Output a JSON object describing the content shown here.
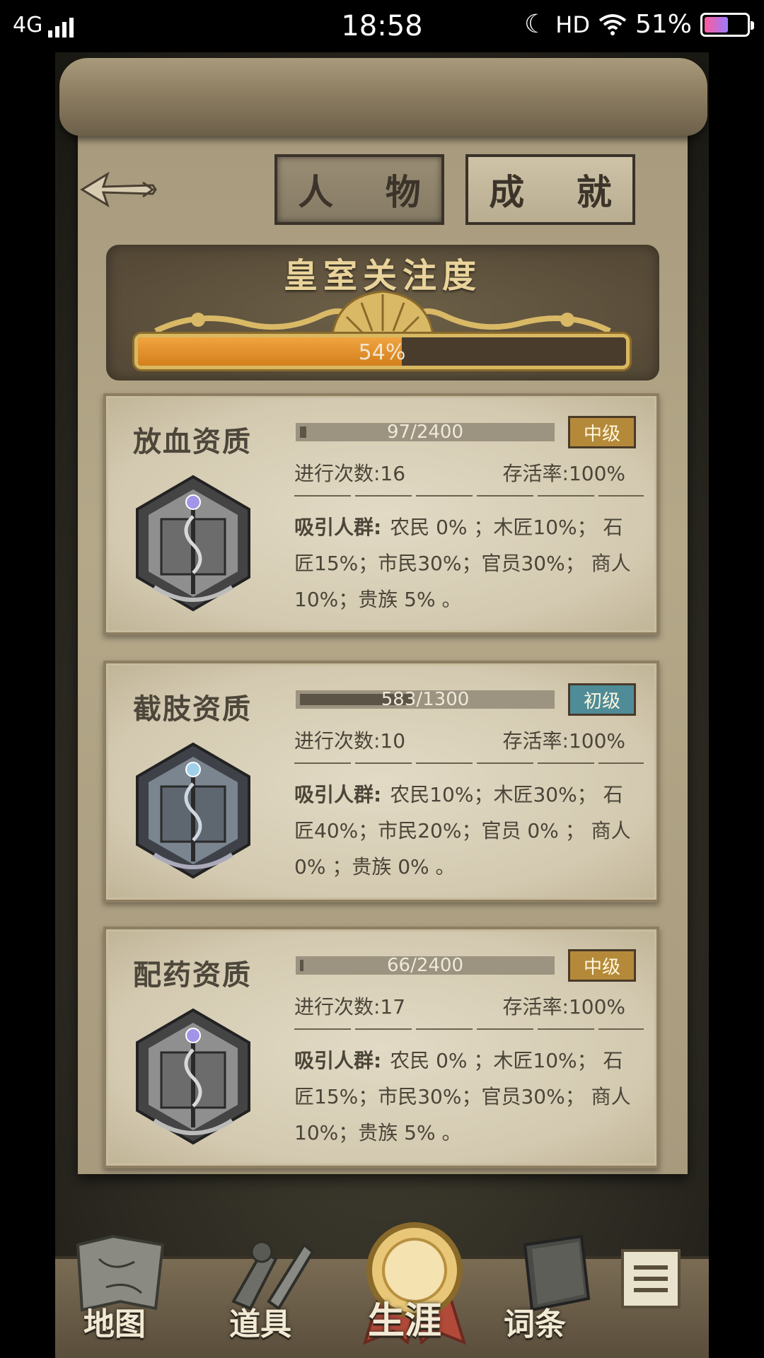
{
  "status_bar": {
    "network": "4G",
    "time": "18:58",
    "hd": "HD",
    "battery": "51%"
  },
  "tabs": {
    "character": "人 物",
    "achievement": "成 就"
  },
  "royal_attention": {
    "title": "皇室关注度",
    "percent_label": "54%",
    "progress": 0.54
  },
  "skills": [
    {
      "name": "放血资质",
      "exp_label": "97/2400",
      "exp_fraction": 0.04,
      "level": "中级",
      "count_label": "进行次数:16",
      "survival_label": "存活率:100%",
      "attract_label": "吸引人群:",
      "attract_text": "农民 0% ；木匠10%； 石匠15%；市民30%；官员30%； 商人10%；贵族 5% 。"
    },
    {
      "name": "截肢资质",
      "exp_label": "583/1300",
      "exp_fraction": 0.45,
      "level": "初级",
      "count_label": "进行次数:10",
      "survival_label": "存活率:100%",
      "attract_label": "吸引人群:",
      "attract_text": "农民10%；木匠30%； 石匠40%；市民20%；官员 0% ； 商人 0% ；贵族 0% 。"
    },
    {
      "name": "配药资质",
      "exp_label": "66/2400",
      "exp_fraction": 0.03,
      "level": "中级",
      "count_label": "进行次数:17",
      "survival_label": "存活率:100%",
      "attract_label": "吸引人群:",
      "attract_text": "农民 0% ；木匠10%； 石匠15%；市民30%；官员30%； 商人10%；贵族 5% 。"
    }
  ],
  "bottom_nav": {
    "map": "地图",
    "items": "道具",
    "career": "生涯",
    "glossary": "词条"
  },
  "colors": {
    "royal_fill": "#e08e2a",
    "level_mid": "#b48a3a",
    "level_low": "#4f8c98"
  }
}
